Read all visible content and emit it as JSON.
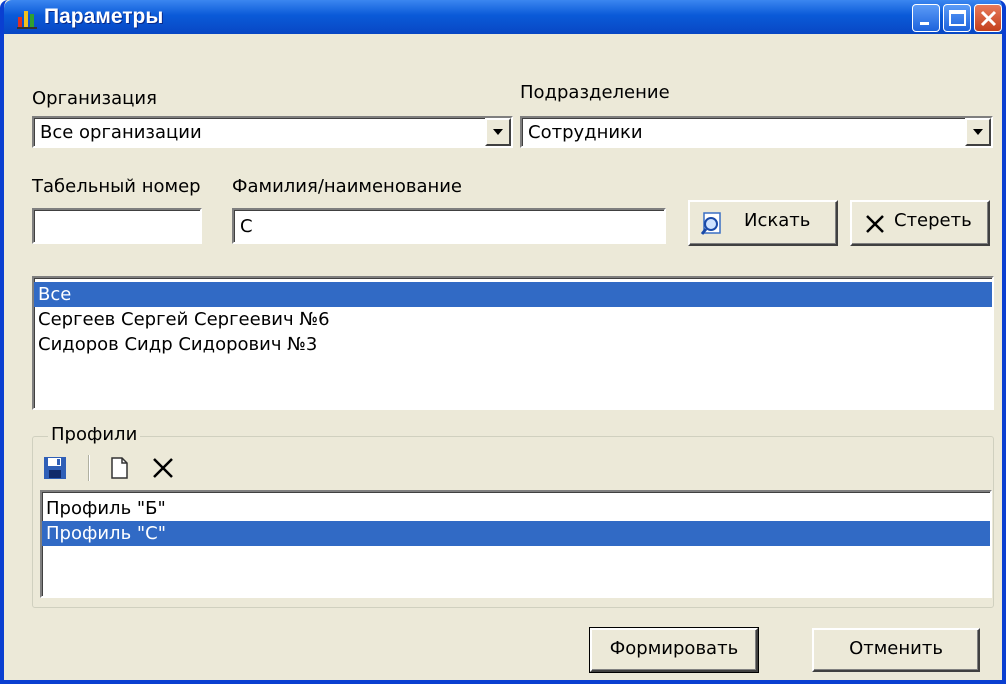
{
  "window": {
    "title": "Параметры"
  },
  "organization": {
    "label": "Организация",
    "value": "Все организации"
  },
  "division": {
    "label": "Подразделение",
    "value": "Сотрудники"
  },
  "tab_number": {
    "label": "Табельный номер",
    "value": ""
  },
  "surname": {
    "label": "Фамилия/наименование",
    "value": "С"
  },
  "buttons": {
    "search": "Искать",
    "clear": "Стереть",
    "generate": "Формировать",
    "cancel": "Отменить"
  },
  "employees": [
    "Все",
    "Сергеев  Сергей  Сергеевич  №6",
    "Сидоров  Сидр  Сидорович  №3"
  ],
  "profiles": {
    "caption": "Профили",
    "items": [
      "Профиль \"Б\"",
      "Профиль \"С\""
    ]
  },
  "colors": {
    "titlebar": "#0a5ad8",
    "selection": "#316ac5",
    "face": "#ece9d8"
  }
}
